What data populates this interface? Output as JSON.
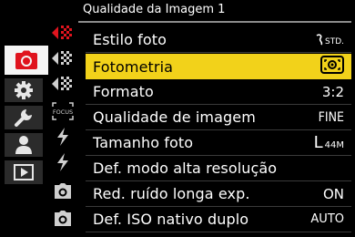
{
  "header": {
    "title": "Qualidade da Imagem 1"
  },
  "main_tabs": [
    {
      "icon": "camera-icon",
      "active": true
    },
    {
      "icon": "gear-icon",
      "active": false
    },
    {
      "icon": "wrench-icon",
      "active": false
    },
    {
      "icon": "person-icon",
      "active": false
    },
    {
      "icon": "playback-icon",
      "active": false
    }
  ],
  "sub_tabs": [
    {
      "icon": "image-quality-icon",
      "active": true
    },
    {
      "icon": "image-quality-icon",
      "active": false
    },
    {
      "icon": "image-quality-icon",
      "active": false
    },
    {
      "icon": "focus-icon",
      "label": "FOCUS",
      "active": false
    },
    {
      "icon": "flash-icon",
      "active": false
    },
    {
      "icon": "flash-icon",
      "active": false
    },
    {
      "icon": "camera-small-icon",
      "active": false
    },
    {
      "icon": "camera-small-icon",
      "active": false
    }
  ],
  "menu": {
    "items": [
      {
        "label": "Estilo foto",
        "value": "STD.",
        "value_icon": "style-standard-icon"
      },
      {
        "label": "Fotometria",
        "value": "",
        "value_icon": "metering-multiple-icon",
        "selected": true
      },
      {
        "label": "Formato",
        "value": "3:2"
      },
      {
        "label": "Qualidade de imagem",
        "value": "FINE"
      },
      {
        "label": "Tamanho foto",
        "value_big": "L",
        "value_small": "44M"
      },
      {
        "label": "Def. modo alta resolução",
        "value": ""
      },
      {
        "label": "Red. ruído longa exp.",
        "value": "ON"
      },
      {
        "label": "Def. ISO nativo duplo",
        "value": "AUTO"
      }
    ]
  },
  "colors": {
    "accent_red": "#e0141e",
    "highlight_yellow": "#f2d21a",
    "background": "#000000",
    "divider": "#8a8a8a"
  }
}
